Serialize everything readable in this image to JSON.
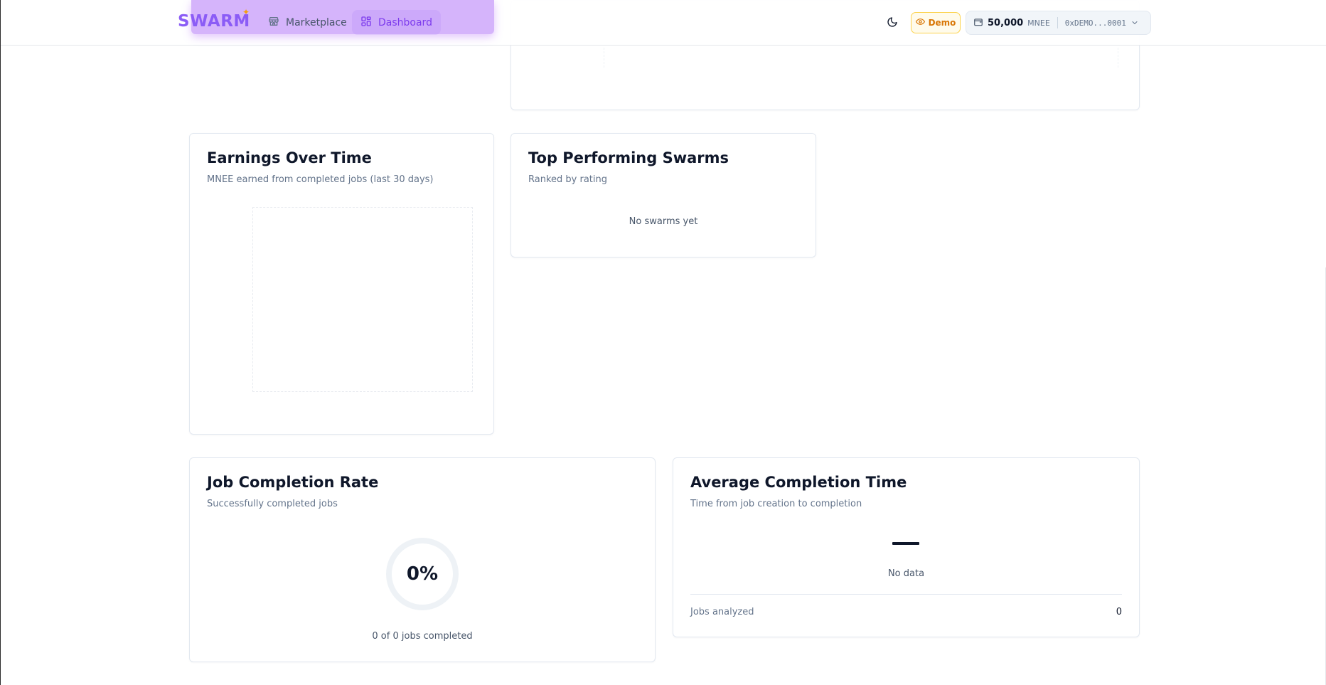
{
  "header": {
    "logo": "SWARM",
    "nav": [
      {
        "label": "Marketplace",
        "icon": "store-icon",
        "active": false
      },
      {
        "label": "Dashboard",
        "icon": "dashboard-grid-icon",
        "active": true
      }
    ],
    "demo_label": "Demo",
    "wallet": {
      "balance": "50,000",
      "unit": "MNEE",
      "address": "0xDEMO...0001"
    }
  },
  "earnings": {
    "title": "Earnings Over Time",
    "subtitle": "MNEE earned from completed jobs (last 30 days)"
  },
  "top_swarms": {
    "title": "Top Performing Swarms",
    "subtitle": "Ranked by rating",
    "empty": "No swarms yet"
  },
  "completion_rate": {
    "title": "Job Completion Rate",
    "subtitle": "Successfully completed jobs",
    "value": "0%",
    "progress_fraction": 0,
    "caption": "0 of 0 jobs completed"
  },
  "avg_time": {
    "title": "Average Completion Time",
    "subtitle": "Time from job creation to completion",
    "value": "—",
    "empty": "No data",
    "jobs_analyzed_label": "Jobs analyzed",
    "jobs_analyzed_value": "0"
  },
  "colors": {
    "accent": "#8b5cf6",
    "demo": "#d97706"
  }
}
